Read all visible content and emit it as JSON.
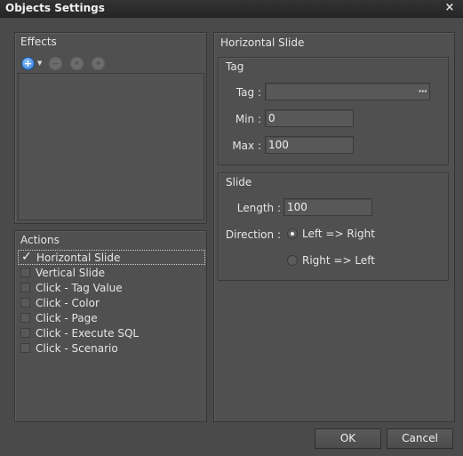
{
  "window": {
    "title": "Objects Settings",
    "close_glyph": "×"
  },
  "effects": {
    "title": "Effects",
    "toolbar": {
      "add_glyph": "+",
      "remove_glyph": "−",
      "up_glyph": "•",
      "down_glyph": "•"
    }
  },
  "actions": {
    "title": "Actions",
    "check_glyph": "✓",
    "items": [
      {
        "label": "Horizontal Slide",
        "checked": true
      },
      {
        "label": "Vertical Slide",
        "checked": false
      },
      {
        "label": "Click - Tag Value",
        "checked": false
      },
      {
        "label": "Click - Color",
        "checked": false
      },
      {
        "label": "Click - Page",
        "checked": false
      },
      {
        "label": "Click - Execute SQL",
        "checked": false
      },
      {
        "label": "Click - Scenario",
        "checked": false
      }
    ]
  },
  "right": {
    "title": "Horizontal Slide",
    "tag_group": {
      "title": "Tag",
      "tag_label": "Tag :",
      "tag_value": "",
      "ellipsis": "···",
      "min_label": "Min :",
      "min_value": "0",
      "max_label": "Max :",
      "max_value": "100"
    },
    "slide_group": {
      "title": "Slide",
      "length_label": "Length :",
      "length_value": "100",
      "direction_label": "Direction :",
      "options": [
        {
          "label": "Left => Right",
          "selected": true
        },
        {
          "label": "Right => Left",
          "selected": false
        }
      ]
    }
  },
  "buttons": {
    "ok": "OK",
    "cancel": "Cancel"
  }
}
